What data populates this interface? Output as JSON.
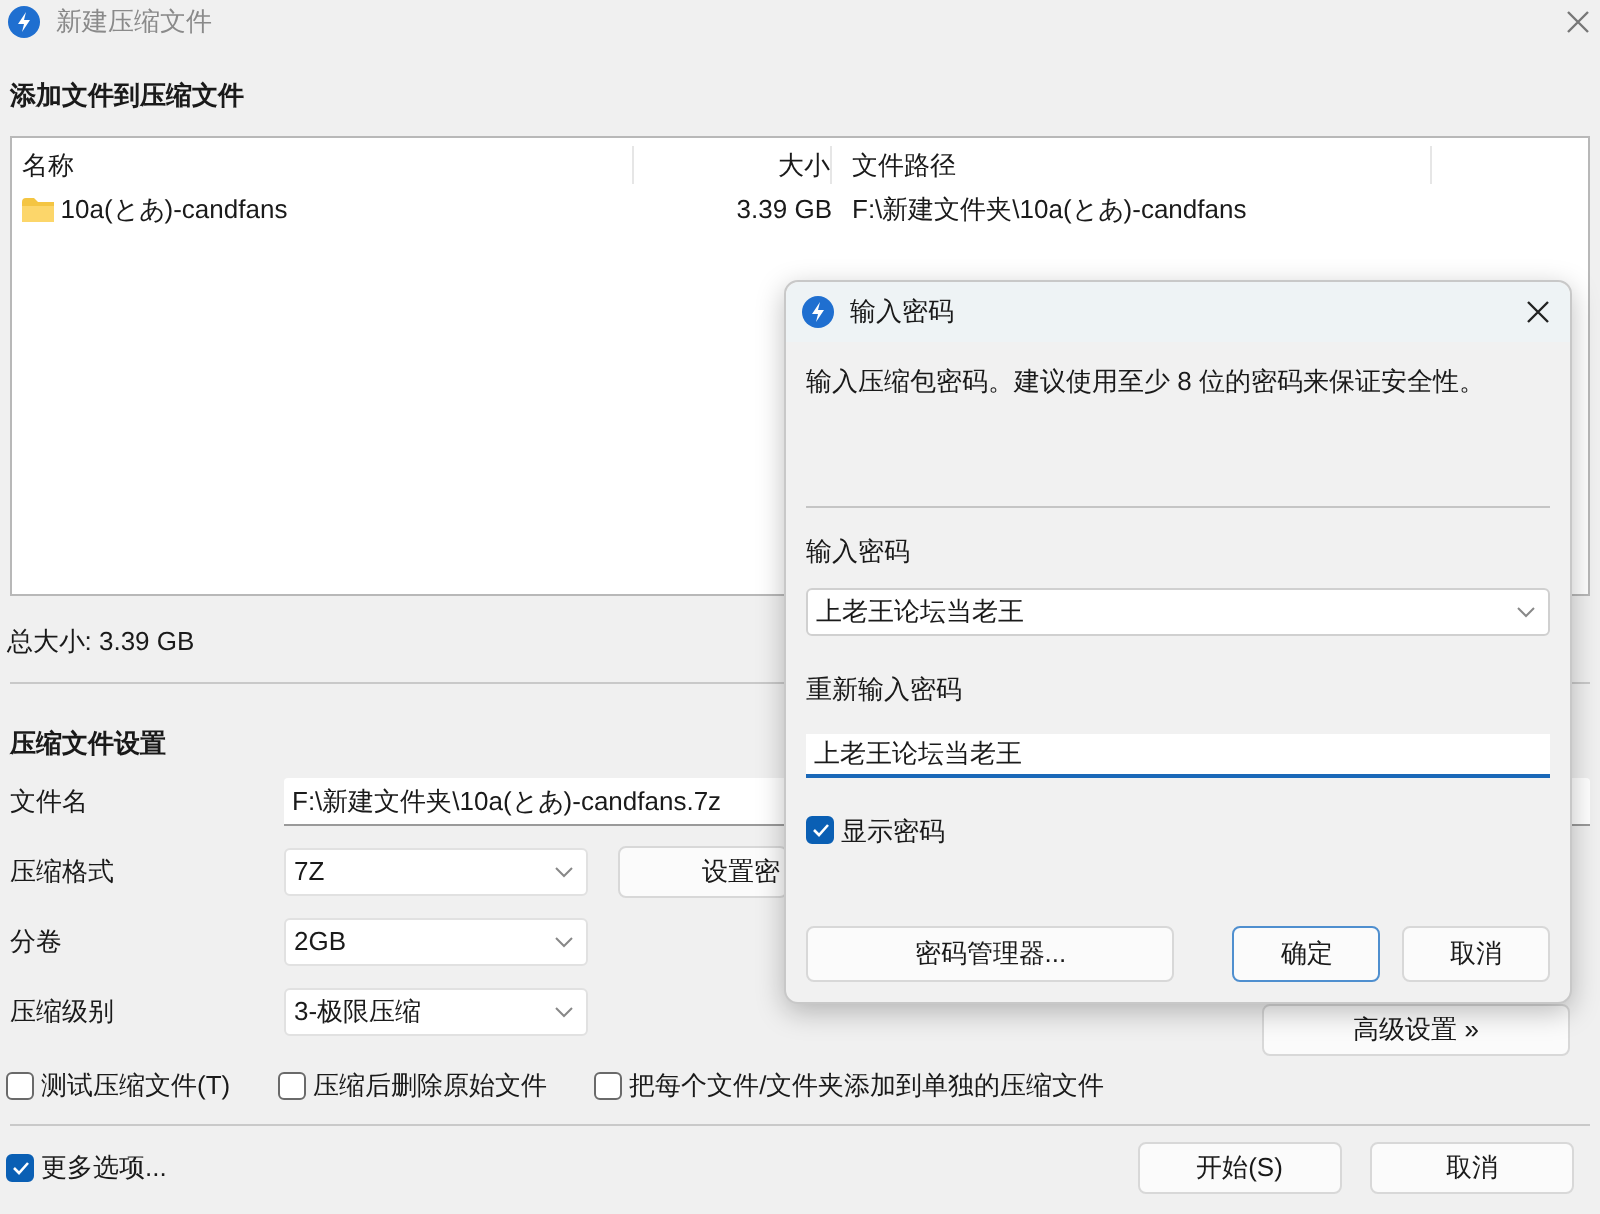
{
  "window": {
    "title": "新建压缩文件"
  },
  "files_section": {
    "heading": "添加文件到压缩文件",
    "columns": [
      "名称",
      "大小",
      "文件路径"
    ],
    "rows": [
      {
        "name": "10a(とあ)-candfans",
        "size": "3.39 GB",
        "path": "F:\\新建文件夹\\10a(とあ)-candfans"
      }
    ],
    "total": "总大小: 3.39 GB"
  },
  "settings": {
    "heading": "压缩文件设置",
    "fields": [
      {
        "kind": "text",
        "label": "文件名",
        "value": "F:\\新建文件夹\\10a(とあ)-candfans.7z"
      },
      {
        "kind": "select",
        "label": "压缩格式",
        "value": "7Z"
      },
      {
        "kind": "select",
        "label": "分卷",
        "value": "2GB"
      },
      {
        "kind": "select",
        "label": "压缩级别",
        "value": "3-极限压缩"
      }
    ],
    "set_password_button": "设置密",
    "advanced_button": "高级设置 »",
    "options": [
      {
        "label": "测试压缩文件(T)",
        "checked": false
      },
      {
        "label": "压缩后删除原始文件",
        "checked": false
      },
      {
        "label": "把每个文件/文件夹添加到单独的压缩文件",
        "checked": false
      }
    ]
  },
  "footer": {
    "more_options": {
      "label": "更多选项...",
      "checked": true
    },
    "buttons": [
      "开始(S)",
      "取消"
    ]
  },
  "password_dialog": {
    "title": "输入密码",
    "message": "输入压缩包密码。建议使用至少 8 位的密码来保证安全性。",
    "password_label": "输入密码",
    "password": "上老王论坛当老王",
    "confirm_label": "重新输入密码",
    "confirm": "上老王论坛当老王",
    "show_password": {
      "label": "显示密码",
      "checked": true
    },
    "buttons": [
      {
        "label": "密码管理器...",
        "default": false
      },
      {
        "label": "确定",
        "default": true
      },
      {
        "label": "取消",
        "default": false
      }
    ]
  }
}
